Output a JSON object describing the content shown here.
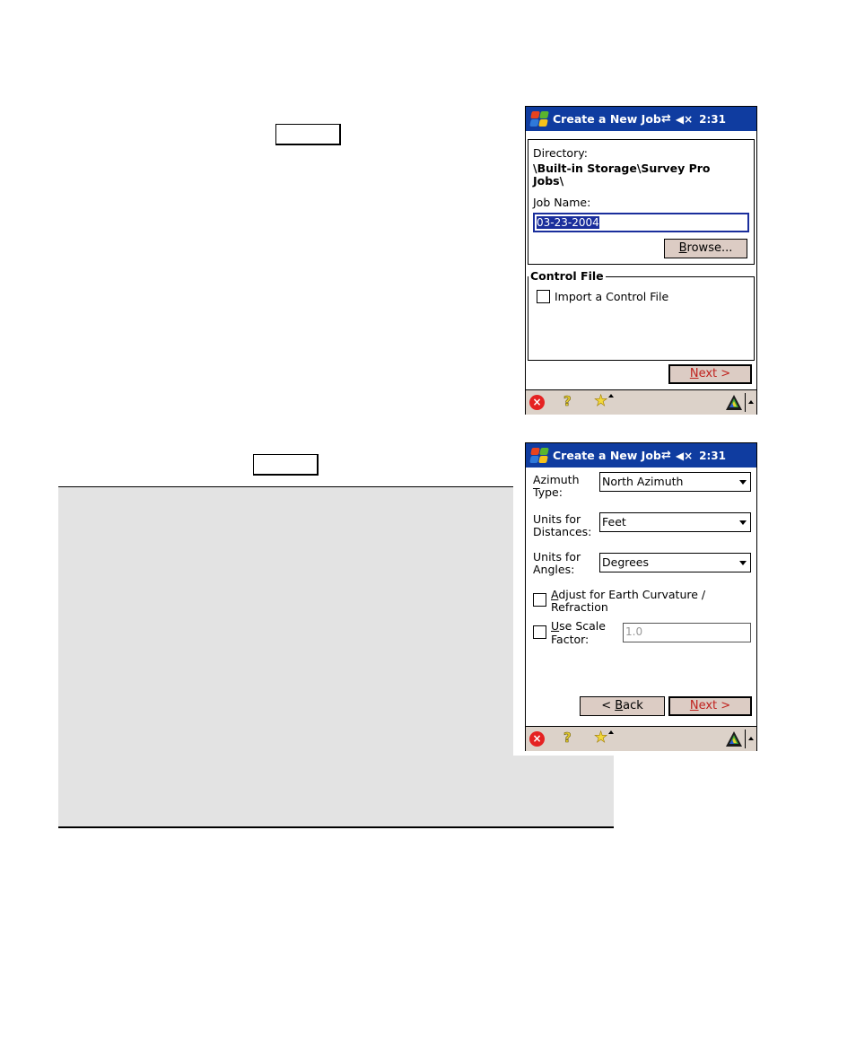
{
  "page": {
    "placeholder_boxes": 2,
    "background_panel_color": "#e3e3e3"
  },
  "screen1": {
    "title": "Create a New Job",
    "time": "2:31",
    "directory_label": "Directory:",
    "directory_value_line1": "\\Built-in Storage\\Survey Pro",
    "directory_value_line2": "Jobs\\",
    "job_name_label": "Job Name:",
    "job_name_value": "03-23-2004",
    "browse_button": {
      "prefix": "",
      "accel": "B",
      "rest": "rowse..."
    },
    "control_file_group": "Control File",
    "import_checkbox_label": "Import a Control File",
    "import_checked": false,
    "next_button": {
      "accel": "N",
      "rest": "ext >"
    }
  },
  "screen2": {
    "title": "Create a New Job",
    "time": "2:31",
    "azimuth_label_1": "Azimuth",
    "azimuth_label_2": "Type:",
    "azimuth_value": "North Azimuth",
    "dist_label_1": "Units for",
    "dist_label_2": "Distances:",
    "dist_value": "Feet",
    "angle_label_1": "Units for",
    "angle_label_2": "Angles:",
    "angle_value": "Degrees",
    "curvature_accel": "A",
    "curvature_label_1": "djust for Earth Curvature /",
    "curvature_label_2": "Refraction",
    "curvature_checked": false,
    "scale_accel": "U",
    "scale_label_1": "se Scale",
    "scale_label_2": "Factor:",
    "scale_checked": false,
    "scale_value": "1.0",
    "back_button": {
      "prefix": "< ",
      "accel": "B",
      "rest": "ack"
    },
    "next_button": {
      "accel": "N",
      "rest": "ext >"
    }
  },
  "taskbar": {
    "close_glyph": "×",
    "help_glyph": "?",
    "star_glyph": "★"
  },
  "colors": {
    "titlebar": "#0f3ca0",
    "default_button_text": "#c0221e",
    "button_face": "#dcccc4",
    "taskbar": "#dcd2c9"
  }
}
